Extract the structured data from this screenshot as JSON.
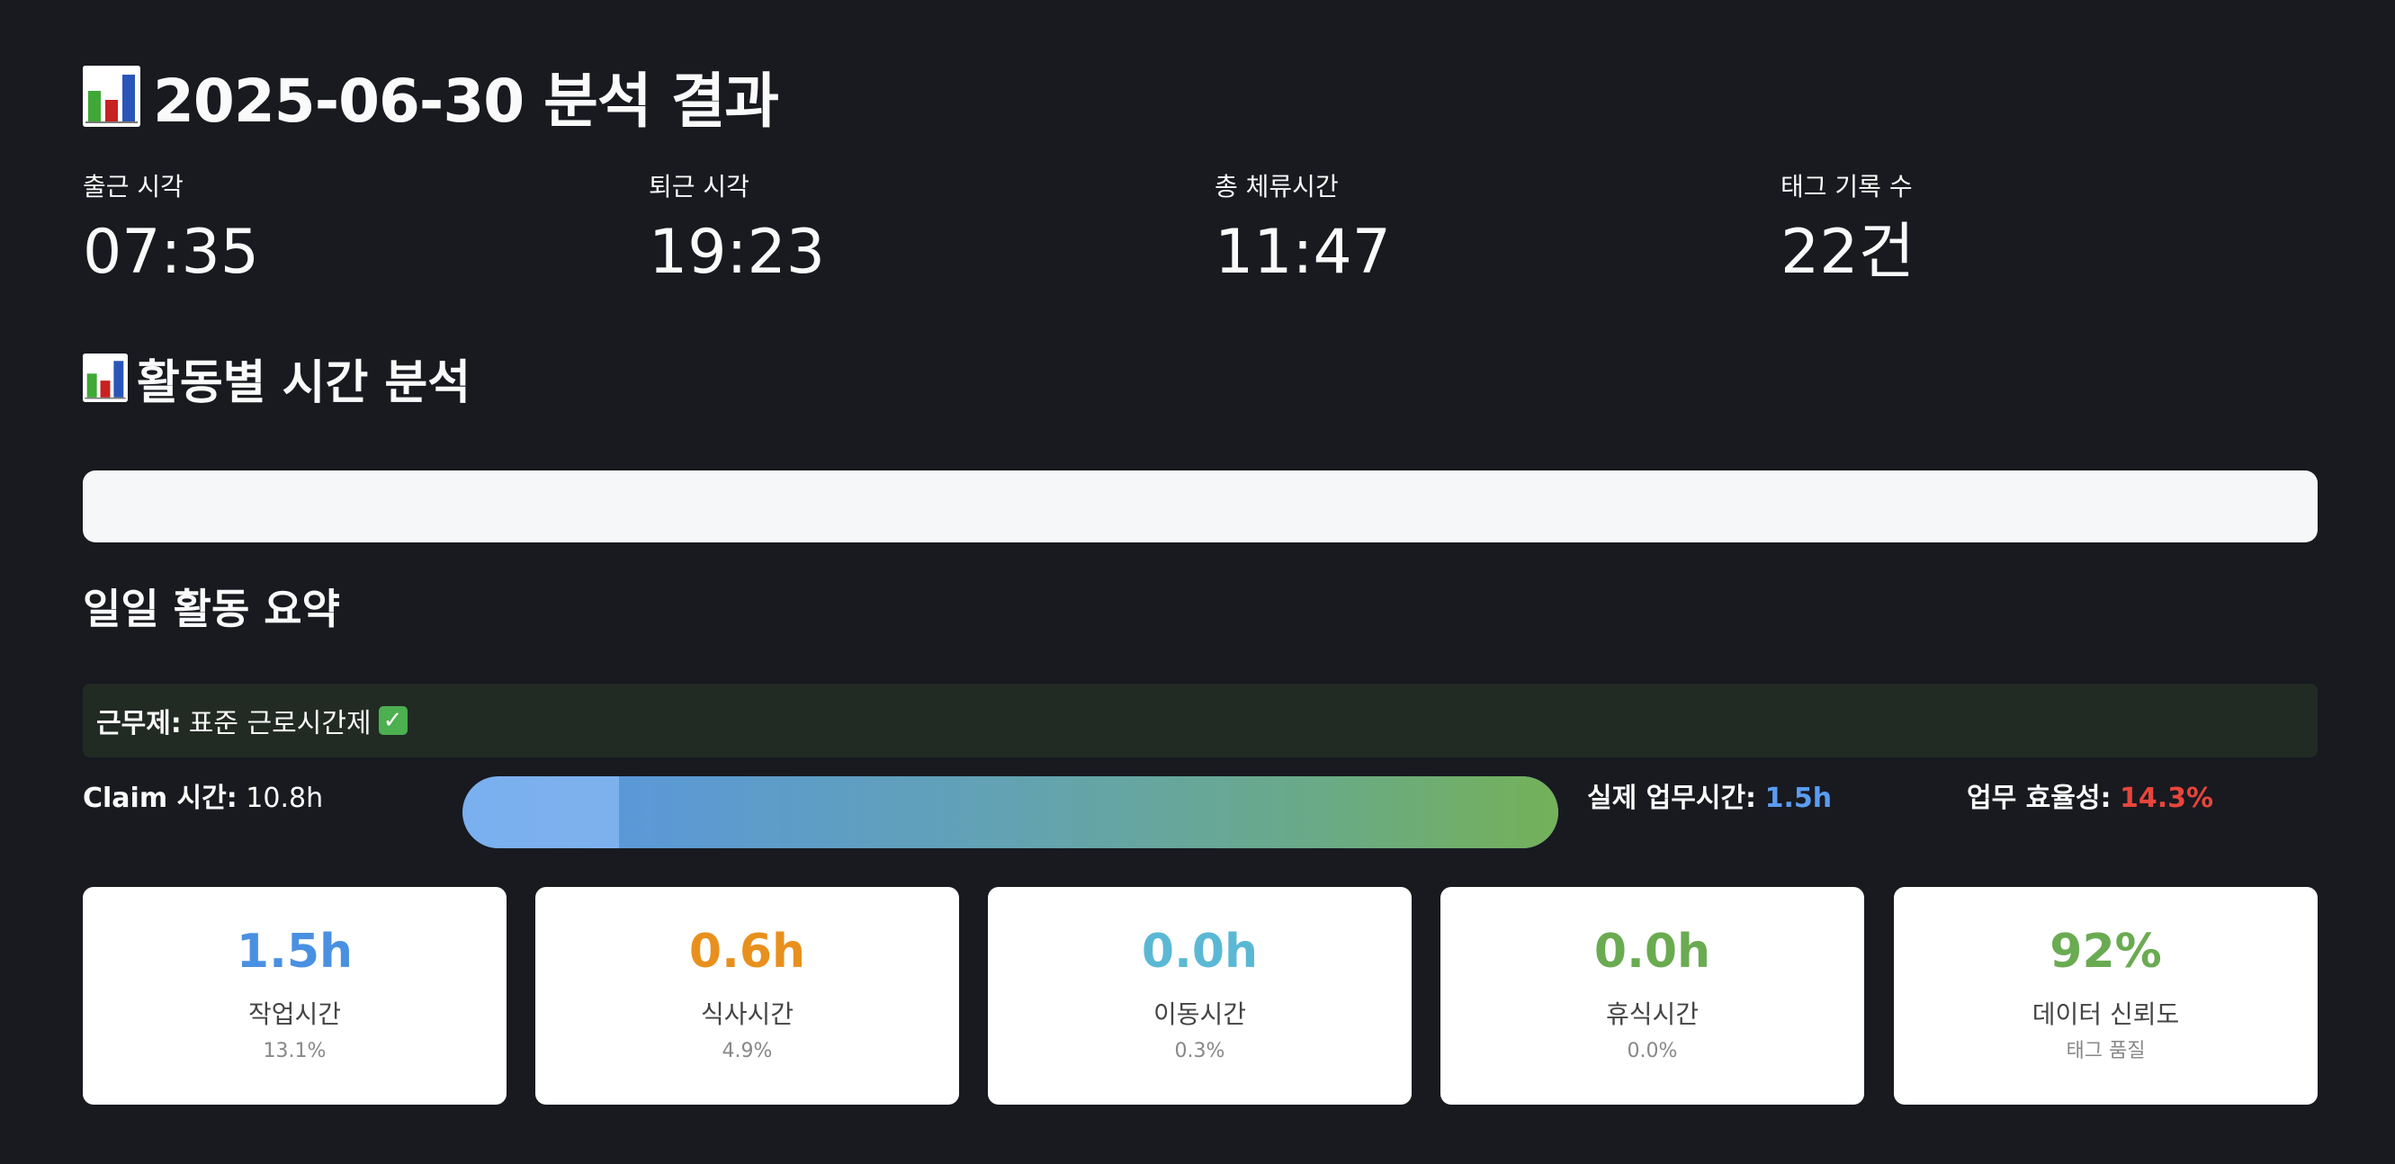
{
  "header": {
    "title": "2025-06-30 분석 결과",
    "icon": "bar-chart-icon"
  },
  "metrics": [
    {
      "label": "출근 시각",
      "value": "07:35"
    },
    {
      "label": "퇴근 시각",
      "value": "19:23"
    },
    {
      "label": "총 체류시간",
      "value": "11:47"
    },
    {
      "label": "태그 기록 수",
      "value": "22건"
    }
  ],
  "activity_section": {
    "title": "활동별 시간 분석",
    "icon": "bar-chart-icon"
  },
  "summary": {
    "title": "일일 활동 요약",
    "work_system_label": "근무제:",
    "work_system_value": "표준 근로시간제",
    "check_icon": "check-mark-icon",
    "claim_label": "Claim 시간:",
    "claim_value": "10.8h",
    "actual_label": "실제 업무시간:",
    "actual_value": "1.5h",
    "efficiency_label": "업무 효율성:",
    "efficiency_value": "14.3%",
    "efficiency_fraction": 0.857,
    "colors": {
      "actual": "#5b9cf0",
      "efficiency": "#e8453c"
    }
  },
  "cards": [
    {
      "value": "1.5h",
      "label": "작업시간",
      "sub": "13.1%",
      "color": "#4a90e2"
    },
    {
      "value": "0.6h",
      "label": "식사시간",
      "sub": "4.9%",
      "color": "#e8901e"
    },
    {
      "value": "0.0h",
      "label": "이동시간",
      "sub": "0.3%",
      "color": "#5bb8d4"
    },
    {
      "value": "0.0h",
      "label": "휴식시간",
      "sub": "0.0%",
      "color": "#6aab52"
    },
    {
      "value": "92%",
      "label": "데이터 신뢰도",
      "sub": "태그 품질",
      "color": "#6aab52"
    }
  ]
}
